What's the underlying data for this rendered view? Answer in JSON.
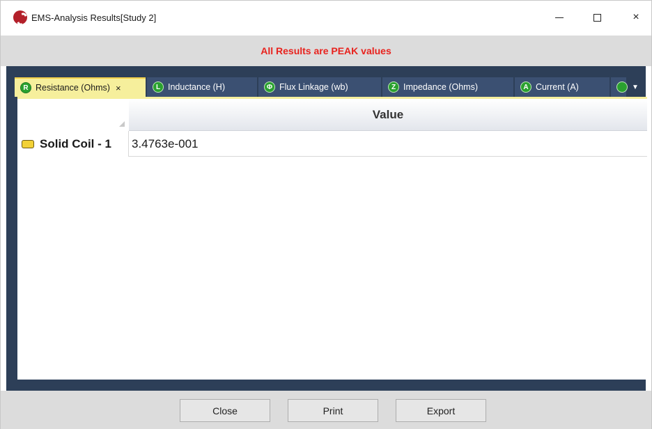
{
  "window": {
    "title": "EMS-Analysis Results[Study 2]",
    "controls": {
      "minimize": "minimize",
      "maximize": "maximize",
      "close": "×"
    }
  },
  "banner": {
    "text": "All Results are PEAK values",
    "color": "#e8231e"
  },
  "tabs": [
    {
      "icon_letter": "R",
      "label": "Resistance (Ohms)",
      "active": true,
      "close": "×"
    },
    {
      "icon_letter": "L",
      "label": "Inductance (H)",
      "active": false
    },
    {
      "icon_letter": "Φ",
      "label": "Flux Linkage (wb)",
      "active": false
    },
    {
      "icon_letter": "Z",
      "label": "Impedance (Ohms)",
      "active": false
    },
    {
      "icon_letter": "A",
      "label": "Current (A)",
      "active": false
    },
    {
      "icon_letter": "",
      "label": "",
      "active": false
    }
  ],
  "tab_menu_icon": "▼",
  "grid": {
    "column_header": "Value",
    "rows": [
      {
        "label": "Solid Coil - 1",
        "value": "3.4763e-001"
      }
    ]
  },
  "buttons": {
    "close": "Close",
    "print": "Print",
    "export": "Export"
  },
  "colors": {
    "frame": "#2d3f58",
    "active_tab": "#f6ef9c",
    "tab_icon": "#2aa12f"
  }
}
